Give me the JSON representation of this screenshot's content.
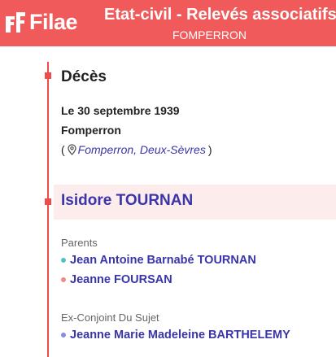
{
  "header": {
    "logo_text": "Filae",
    "title": "Etat-civil - Relevés associatifs",
    "subtitle": "FOMPERRON",
    "colors": {
      "brand": "#f05a5a",
      "link": "#3a35a8"
    }
  },
  "event": {
    "title": "Décès",
    "date": "Le 30 septembre 1939",
    "place": "Fomperron",
    "location": {
      "open_paren": "(",
      "icon": "map-pin-icon",
      "city": "Fomperron",
      "separator": ", ",
      "region": "Deux-Sèvres",
      "close_paren": ")"
    }
  },
  "person": {
    "name": "Isidore TOURNAN"
  },
  "parents": {
    "label": "Parents",
    "items": [
      {
        "name": "Jean Antoine Barnabé TOURNAN",
        "bullet_color": "#4bc4c4"
      },
      {
        "name": "Jeanne FOURSAN",
        "bullet_color": "#f08a8a"
      }
    ]
  },
  "ex_spouse": {
    "label": "Ex-Conjoint Du Sujet",
    "items": [
      {
        "name": "Jeanne Marie Madeleine BARTHELEMY",
        "bullet_color": "#8a8ae8"
      }
    ]
  }
}
